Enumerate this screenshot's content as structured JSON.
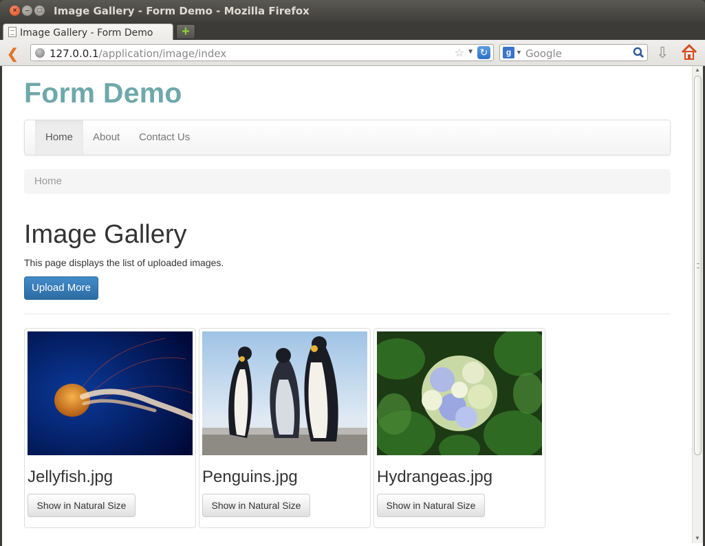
{
  "window": {
    "title": "Image Gallery - Form Demo - Mozilla Firefox",
    "tab_label": "Image Gallery - Form Demo"
  },
  "browser": {
    "url_host": "127.0.0.1",
    "url_path": "/application/image/index",
    "search_placeholder": "Google",
    "new_tab_symbol": "+",
    "accent_color": "#e0772a"
  },
  "site": {
    "brand": "Form Demo",
    "brand_color": "#6ea8aa",
    "nav": [
      {
        "label": "Home",
        "active": true
      },
      {
        "label": "About",
        "active": false
      },
      {
        "label": "Contact Us",
        "active": false
      }
    ],
    "breadcrumb": "Home"
  },
  "main": {
    "title": "Image Gallery",
    "description": "This page displays the list of uploaded images.",
    "upload_button": "Upload More",
    "images": [
      {
        "caption": "Jellyfish.jpg",
        "button": "Show in Natural Size",
        "image": "jellyfish-photo"
      },
      {
        "caption": "Penguins.jpg",
        "button": "Show in Natural Size",
        "image": "penguins-photo"
      },
      {
        "caption": "Hydrangeas.jpg",
        "button": "Show in Natural Size",
        "image": "hydrangeas-photo"
      }
    ]
  }
}
